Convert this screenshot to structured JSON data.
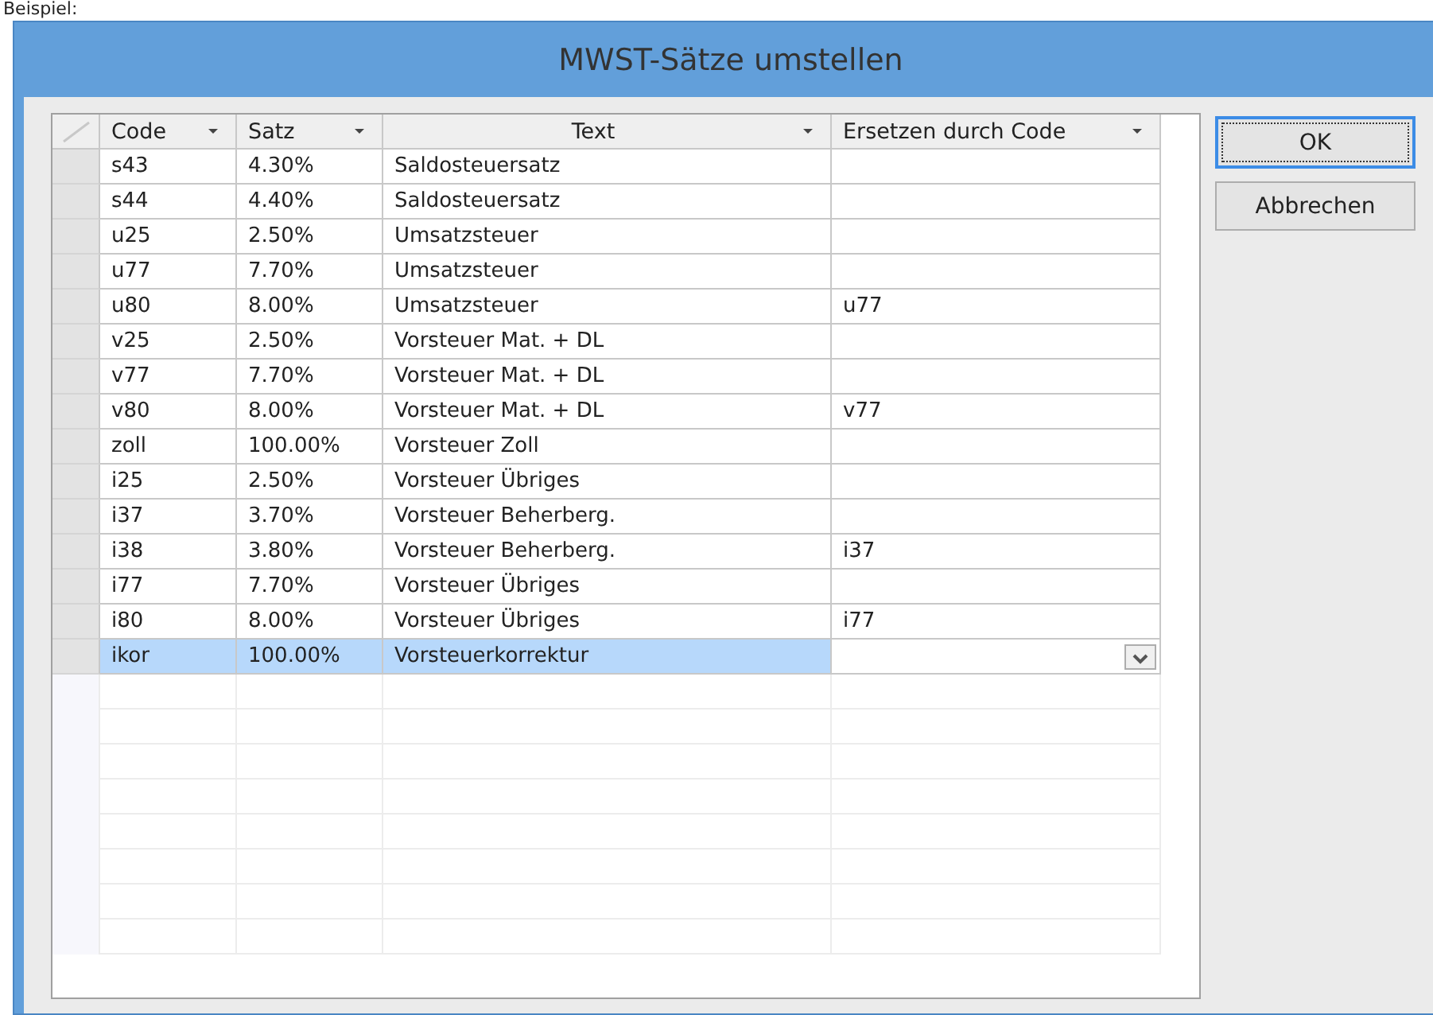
{
  "caption": "Beispiel:",
  "window": {
    "title": "MWST-Sätze umstellen"
  },
  "table": {
    "columns": [
      {
        "label": "Code"
      },
      {
        "label": "Satz"
      },
      {
        "label": "Text"
      },
      {
        "label": "Ersetzen durch Code"
      }
    ],
    "rows": [
      {
        "cells": [
          "s43",
          "4.30%",
          "Saldosteuersatz",
          ""
        ],
        "selected": false
      },
      {
        "cells": [
          "s44",
          "4.40%",
          "Saldosteuersatz",
          ""
        ],
        "selected": false
      },
      {
        "cells": [
          "u25",
          "2.50%",
          "Umsatzsteuer",
          ""
        ],
        "selected": false
      },
      {
        "cells": [
          "u77",
          "7.70%",
          "Umsatzsteuer",
          ""
        ],
        "selected": false
      },
      {
        "cells": [
          "u80",
          "8.00%",
          "Umsatzsteuer",
          "u77"
        ],
        "selected": false
      },
      {
        "cells": [
          "v25",
          "2.50%",
          "Vorsteuer Mat. + DL",
          ""
        ],
        "selected": false
      },
      {
        "cells": [
          "v77",
          "7.70%",
          "Vorsteuer Mat. + DL",
          ""
        ],
        "selected": false
      },
      {
        "cells": [
          "v80",
          "8.00%",
          "Vorsteuer Mat. + DL",
          "v77"
        ],
        "selected": false
      },
      {
        "cells": [
          "zoll",
          "100.00%",
          "Vorsteuer Zoll",
          ""
        ],
        "selected": false
      },
      {
        "cells": [
          "i25",
          "2.50%",
          "Vorsteuer Übriges",
          ""
        ],
        "selected": false
      },
      {
        "cells": [
          "i37",
          "3.70%",
          "Vorsteuer Beherberg.",
          ""
        ],
        "selected": false
      },
      {
        "cells": [
          "i38",
          "3.80%",
          "Vorsteuer Beherberg.",
          "i37"
        ],
        "selected": false
      },
      {
        "cells": [
          "i77",
          "7.70%",
          "Vorsteuer Übriges",
          ""
        ],
        "selected": false
      },
      {
        "cells": [
          "i80",
          "8.00%",
          "Vorsteuer Übriges",
          "i77"
        ],
        "selected": false
      },
      {
        "cells": [
          "ikor",
          "100.00%",
          "Vorsteuerkorrektur",
          ""
        ],
        "selected": true
      }
    ]
  },
  "buttons": [
    {
      "label": "OK",
      "default": true
    },
    {
      "label": "Abbrechen",
      "default": false
    }
  ]
}
